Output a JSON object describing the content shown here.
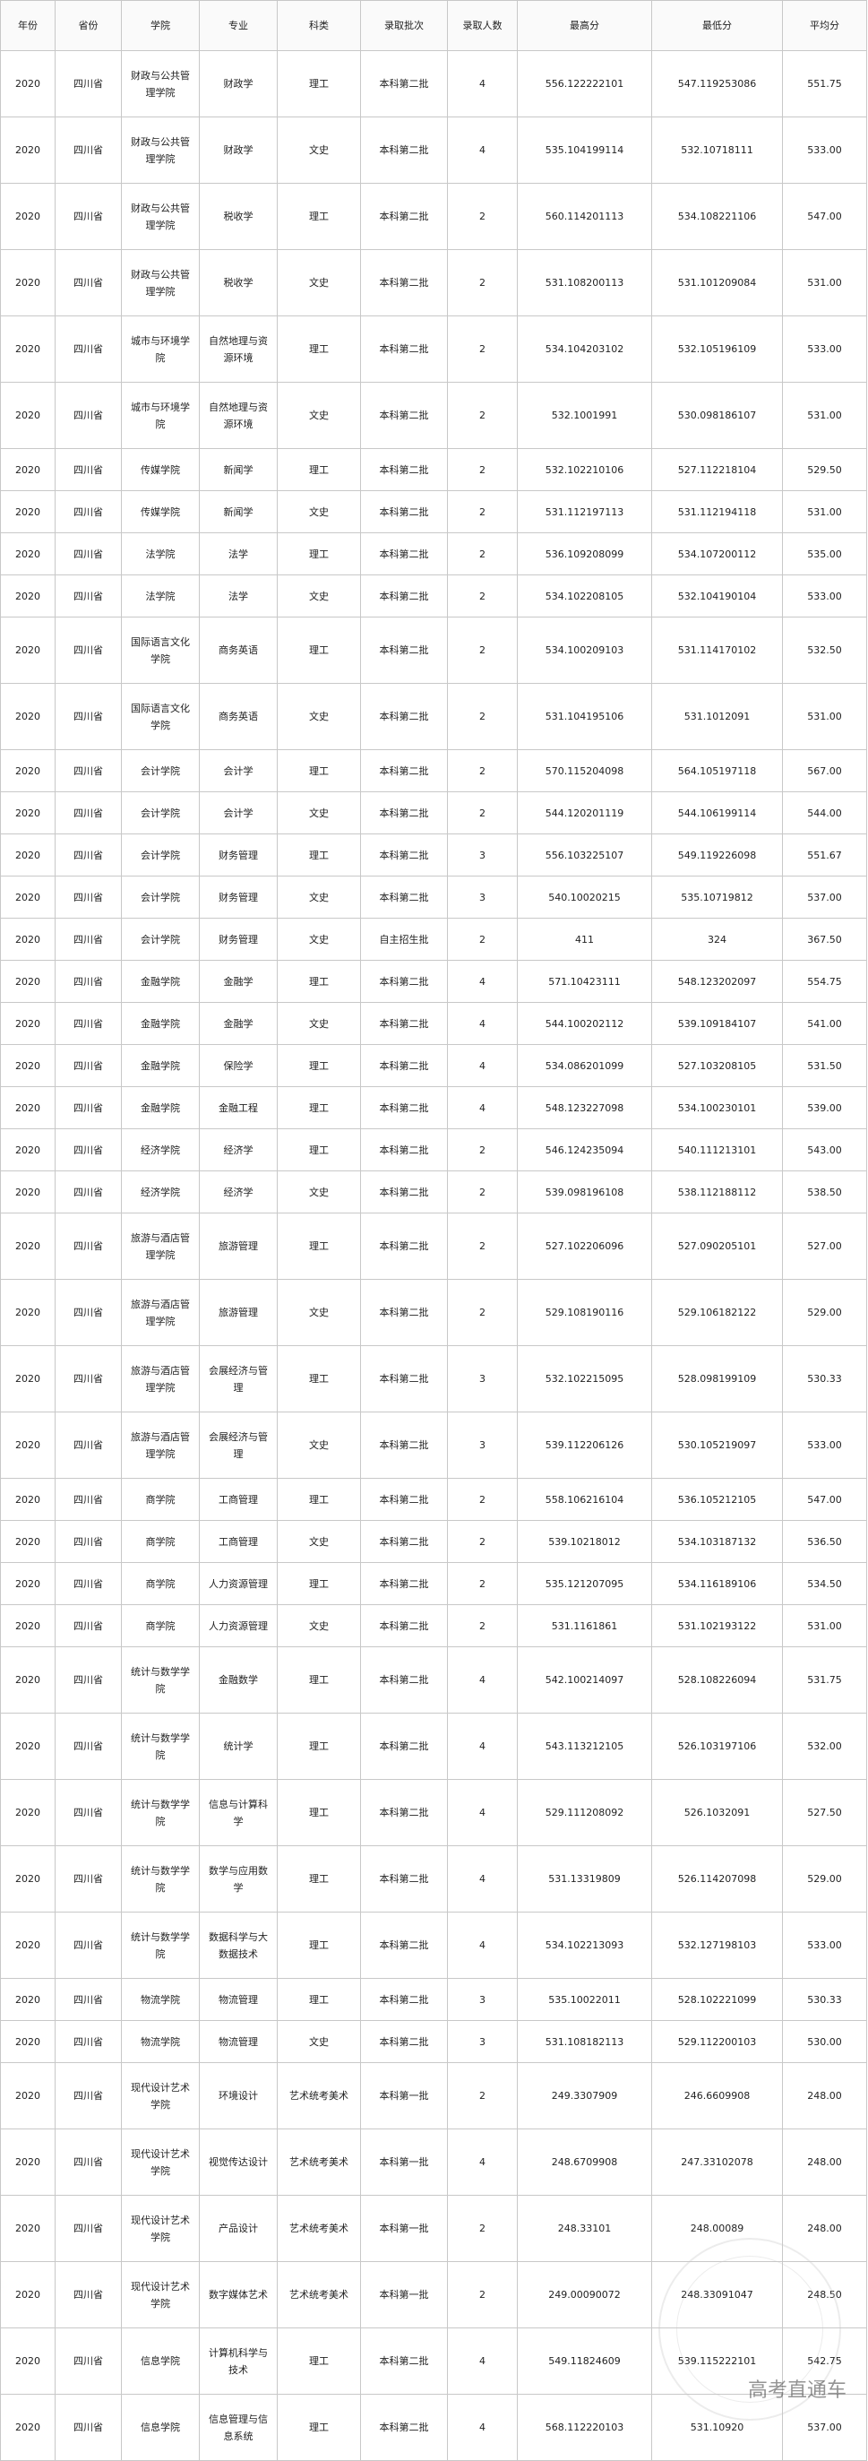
{
  "headers": [
    "年份",
    "省份",
    "学院",
    "专业",
    "科类",
    "录取批次",
    "录取人数",
    "最高分",
    "最低分",
    "平均分"
  ],
  "rows": [
    [
      "2020",
      "四川省",
      "财政与公共管理学院",
      "财政学",
      "理工",
      "本科第二批",
      "4",
      "556.122222101",
      "547.119253086",
      "551.75"
    ],
    [
      "2020",
      "四川省",
      "财政与公共管理学院",
      "财政学",
      "文史",
      "本科第二批",
      "4",
      "535.104199114",
      "532.10718111",
      "533.00"
    ],
    [
      "2020",
      "四川省",
      "财政与公共管理学院",
      "税收学",
      "理工",
      "本科第二批",
      "2",
      "560.114201113",
      "534.108221106",
      "547.00"
    ],
    [
      "2020",
      "四川省",
      "财政与公共管理学院",
      "税收学",
      "文史",
      "本科第二批",
      "2",
      "531.108200113",
      "531.101209084",
      "531.00"
    ],
    [
      "2020",
      "四川省",
      "城市与环境学院",
      "自然地理与资源环境",
      "理工",
      "本科第二批",
      "2",
      "534.104203102",
      "532.105196109",
      "533.00"
    ],
    [
      "2020",
      "四川省",
      "城市与环境学院",
      "自然地理与资源环境",
      "文史",
      "本科第二批",
      "2",
      "532.1001991",
      "530.098186107",
      "531.00"
    ],
    [
      "2020",
      "四川省",
      "传媒学院",
      "新闻学",
      "理工",
      "本科第二批",
      "2",
      "532.102210106",
      "527.112218104",
      "529.50"
    ],
    [
      "2020",
      "四川省",
      "传媒学院",
      "新闻学",
      "文史",
      "本科第二批",
      "2",
      "531.112197113",
      "531.112194118",
      "531.00"
    ],
    [
      "2020",
      "四川省",
      "法学院",
      "法学",
      "理工",
      "本科第二批",
      "2",
      "536.109208099",
      "534.107200112",
      "535.00"
    ],
    [
      "2020",
      "四川省",
      "法学院",
      "法学",
      "文史",
      "本科第二批",
      "2",
      "534.102208105",
      "532.104190104",
      "533.00"
    ],
    [
      "2020",
      "四川省",
      "国际语言文化学院",
      "商务英语",
      "理工",
      "本科第二批",
      "2",
      "534.100209103",
      "531.114170102",
      "532.50"
    ],
    [
      "2020",
      "四川省",
      "国际语言文化学院",
      "商务英语",
      "文史",
      "本科第二批",
      "2",
      "531.104195106",
      "531.1012091",
      "531.00"
    ],
    [
      "2020",
      "四川省",
      "会计学院",
      "会计学",
      "理工",
      "本科第二批",
      "2",
      "570.115204098",
      "564.105197118",
      "567.00"
    ],
    [
      "2020",
      "四川省",
      "会计学院",
      "会计学",
      "文史",
      "本科第二批",
      "2",
      "544.120201119",
      "544.106199114",
      "544.00"
    ],
    [
      "2020",
      "四川省",
      "会计学院",
      "财务管理",
      "理工",
      "本科第二批",
      "3",
      "556.103225107",
      "549.119226098",
      "551.67"
    ],
    [
      "2020",
      "四川省",
      "会计学院",
      "财务管理",
      "文史",
      "本科第二批",
      "3",
      "540.10020215",
      "535.10719812",
      "537.00"
    ],
    [
      "2020",
      "四川省",
      "会计学院",
      "财务管理",
      "文史",
      "自主招生批",
      "2",
      "411",
      "324",
      "367.50"
    ],
    [
      "2020",
      "四川省",
      "金融学院",
      "金融学",
      "理工",
      "本科第二批",
      "4",
      "571.10423111",
      "548.123202097",
      "554.75"
    ],
    [
      "2020",
      "四川省",
      "金融学院",
      "金融学",
      "文史",
      "本科第二批",
      "4",
      "544.100202112",
      "539.109184107",
      "541.00"
    ],
    [
      "2020",
      "四川省",
      "金融学院",
      "保险学",
      "理工",
      "本科第二批",
      "4",
      "534.086201099",
      "527.103208105",
      "531.50"
    ],
    [
      "2020",
      "四川省",
      "金融学院",
      "金融工程",
      "理工",
      "本科第二批",
      "4",
      "548.123227098",
      "534.100230101",
      "539.00"
    ],
    [
      "2020",
      "四川省",
      "经济学院",
      "经济学",
      "理工",
      "本科第二批",
      "2",
      "546.124235094",
      "540.111213101",
      "543.00"
    ],
    [
      "2020",
      "四川省",
      "经济学院",
      "经济学",
      "文史",
      "本科第二批",
      "2",
      "539.098196108",
      "538.112188112",
      "538.50"
    ],
    [
      "2020",
      "四川省",
      "旅游与酒店管理学院",
      "旅游管理",
      "理工",
      "本科第二批",
      "2",
      "527.102206096",
      "527.090205101",
      "527.00"
    ],
    [
      "2020",
      "四川省",
      "旅游与酒店管理学院",
      "旅游管理",
      "文史",
      "本科第二批",
      "2",
      "529.108190116",
      "529.106182122",
      "529.00"
    ],
    [
      "2020",
      "四川省",
      "旅游与酒店管理学院",
      "会展经济与管理",
      "理工",
      "本科第二批",
      "3",
      "532.102215095",
      "528.098199109",
      "530.33"
    ],
    [
      "2020",
      "四川省",
      "旅游与酒店管理学院",
      "会展经济与管理",
      "文史",
      "本科第二批",
      "3",
      "539.112206126",
      "530.105219097",
      "533.00"
    ],
    [
      "2020",
      "四川省",
      "商学院",
      "工商管理",
      "理工",
      "本科第二批",
      "2",
      "558.106216104",
      "536.105212105",
      "547.00"
    ],
    [
      "2020",
      "四川省",
      "商学院",
      "工商管理",
      "文史",
      "本科第二批",
      "2",
      "539.10218012",
      "534.103187132",
      "536.50"
    ],
    [
      "2020",
      "四川省",
      "商学院",
      "人力资源管理",
      "理工",
      "本科第二批",
      "2",
      "535.121207095",
      "534.116189106",
      "534.50"
    ],
    [
      "2020",
      "四川省",
      "商学院",
      "人力资源管理",
      "文史",
      "本科第二批",
      "2",
      "531.1161861",
      "531.102193122",
      "531.00"
    ],
    [
      "2020",
      "四川省",
      "统计与数学学院",
      "金融数学",
      "理工",
      "本科第二批",
      "4",
      "542.100214097",
      "528.108226094",
      "531.75"
    ],
    [
      "2020",
      "四川省",
      "统计与数学学院",
      "统计学",
      "理工",
      "本科第二批",
      "4",
      "543.113212105",
      "526.103197106",
      "532.00"
    ],
    [
      "2020",
      "四川省",
      "统计与数学学院",
      "信息与计算科学",
      "理工",
      "本科第二批",
      "4",
      "529.111208092",
      "526.1032091",
      "527.50"
    ],
    [
      "2020",
      "四川省",
      "统计与数学学院",
      "数学与应用数学",
      "理工",
      "本科第二批",
      "4",
      "531.13319809",
      "526.114207098",
      "529.00"
    ],
    [
      "2020",
      "四川省",
      "统计与数学学院",
      "数据科学与大数据技术",
      "理工",
      "本科第二批",
      "4",
      "534.102213093",
      "532.127198103",
      "533.00"
    ],
    [
      "2020",
      "四川省",
      "物流学院",
      "物流管理",
      "理工",
      "本科第二批",
      "3",
      "535.10022011",
      "528.102221099",
      "530.33"
    ],
    [
      "2020",
      "四川省",
      "物流学院",
      "物流管理",
      "文史",
      "本科第二批",
      "3",
      "531.108182113",
      "529.112200103",
      "530.00"
    ],
    [
      "2020",
      "四川省",
      "现代设计艺术学院",
      "环境设计",
      "艺术统考美术",
      "本科第一批",
      "2",
      "249.3307909",
      "246.6609908",
      "248.00"
    ],
    [
      "2020",
      "四川省",
      "现代设计艺术学院",
      "视觉传达设计",
      "艺术统考美术",
      "本科第一批",
      "4",
      "248.6709908",
      "247.33102078",
      "248.00"
    ],
    [
      "2020",
      "四川省",
      "现代设计艺术学院",
      "产品设计",
      "艺术统考美术",
      "本科第一批",
      "2",
      "248.33101",
      "248.00089",
      "248.00"
    ],
    [
      "2020",
      "四川省",
      "现代设计艺术学院",
      "数字媒体艺术",
      "艺术统考美术",
      "本科第一批",
      "2",
      "249.00090072",
      "248.33091047",
      "248.50"
    ],
    [
      "2020",
      "四川省",
      "信息学院",
      "计算机科学与技术",
      "理工",
      "本科第二批",
      "4",
      "549.11824609",
      "539.115222101",
      "542.75"
    ],
    [
      "2020",
      "四川省",
      "信息学院",
      "信息管理与信息系统",
      "理工",
      "本科第二批",
      "4",
      "568.112220103",
      "531.10920",
      "537.00"
    ]
  ],
  "tall_rows": [
    0,
    1,
    2,
    3,
    4,
    5,
    10,
    11,
    23,
    24,
    25,
    26,
    31,
    32,
    33,
    34,
    35,
    38,
    39,
    40,
    41,
    42,
    43
  ],
  "watermark": "高考直通车"
}
